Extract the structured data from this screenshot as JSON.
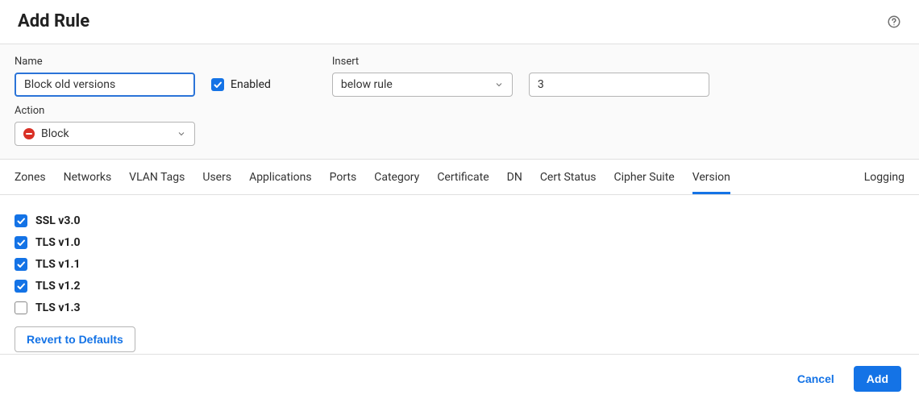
{
  "header": {
    "title": "Add Rule"
  },
  "form": {
    "name_label": "Name",
    "name_value": "Block old versions",
    "enabled_label": "Enabled",
    "enabled_checked": true,
    "insert_label": "Insert",
    "insert_select_value": "below rule",
    "insert_number_value": "3",
    "action_label": "Action",
    "action_value": "Block"
  },
  "tabs": [
    {
      "label": "Zones",
      "active": false
    },
    {
      "label": "Networks",
      "active": false
    },
    {
      "label": "VLAN Tags",
      "active": false
    },
    {
      "label": "Users",
      "active": false
    },
    {
      "label": "Applications",
      "active": false
    },
    {
      "label": "Ports",
      "active": false
    },
    {
      "label": "Category",
      "active": false
    },
    {
      "label": "Certificate",
      "active": false
    },
    {
      "label": "DN",
      "active": false
    },
    {
      "label": "Cert Status",
      "active": false
    },
    {
      "label": "Cipher Suite",
      "active": false
    },
    {
      "label": "Version",
      "active": true
    }
  ],
  "tabs_right": {
    "label": "Logging"
  },
  "versions": [
    {
      "label": "SSL v3.0",
      "checked": true
    },
    {
      "label": "TLS v1.0",
      "checked": true
    },
    {
      "label": "TLS v1.1",
      "checked": true
    },
    {
      "label": "TLS v1.2",
      "checked": true
    },
    {
      "label": "TLS v1.3",
      "checked": false
    }
  ],
  "buttons": {
    "revert": "Revert to Defaults",
    "cancel": "Cancel",
    "add": "Add"
  }
}
